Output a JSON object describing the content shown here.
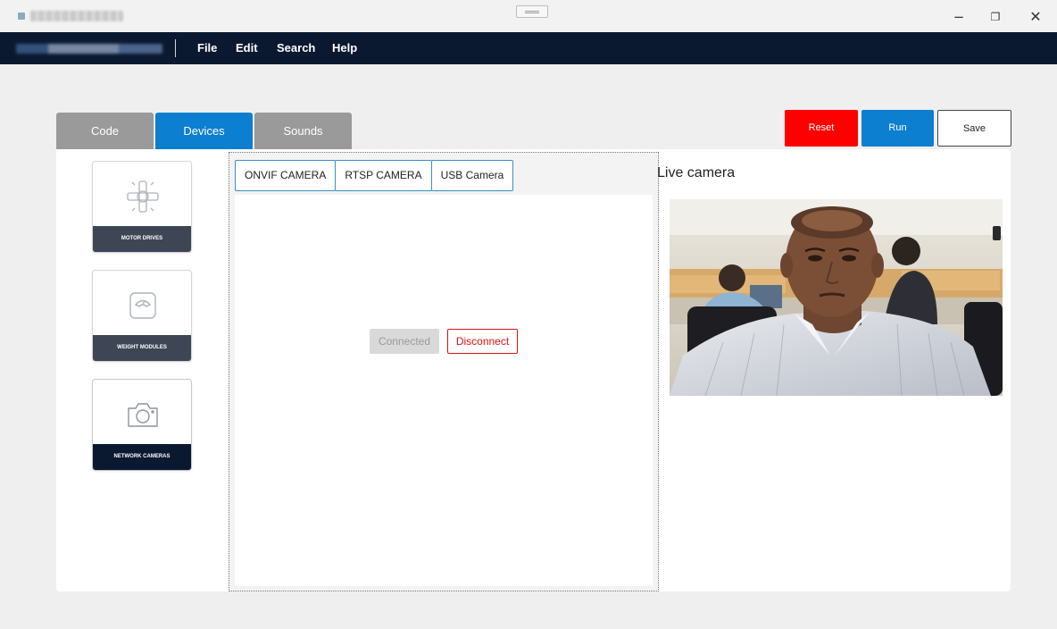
{
  "window": {
    "minimize_glyph": "−",
    "maximize_glyph": "❐",
    "close_glyph": "✕"
  },
  "menu": {
    "items": [
      "File",
      "Edit",
      "Search",
      "Help"
    ]
  },
  "tabs": {
    "items": [
      "Code",
      "Devices",
      "Sounds"
    ],
    "active": "Devices"
  },
  "actions": {
    "reset_label": "Reset",
    "run_label": "Run",
    "save_label": "Save"
  },
  "devices": {
    "cards": [
      {
        "label": "MOTOR DRIVES",
        "icon": "motor-drive-icon"
      },
      {
        "label": "WEIGHT MODULES",
        "icon": "scale-icon"
      },
      {
        "label": "NETWORK CAMERAS",
        "icon": "camera-icon"
      }
    ]
  },
  "camera": {
    "tabs": [
      "ONVIF CAMERA",
      "RTSP CAMERA",
      "USB Camera"
    ],
    "connected_label": "Connected",
    "disconnect_label": "Disconnect"
  },
  "live": {
    "title": "Live camera"
  },
  "colors": {
    "menubar": "#0b1930",
    "accent_blue": "#0d7fd0",
    "reset_red": "#ff0000",
    "inactive_tab": "#9a9a9a"
  }
}
